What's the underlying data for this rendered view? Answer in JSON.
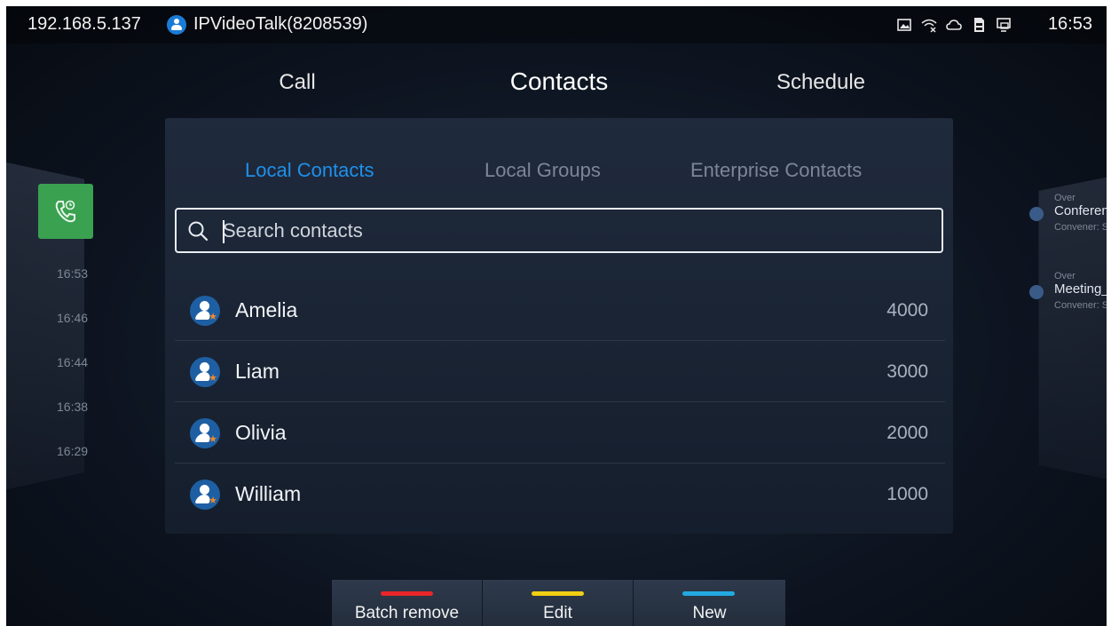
{
  "status_bar": {
    "ip": "192.168.5.137",
    "account": "IPVideoTalk(8208539)",
    "time": "16:53",
    "icons": [
      "gallery-icon",
      "wifi-off-icon",
      "cloud-icon",
      "sd-card-icon",
      "monitor-icon"
    ]
  },
  "main_tabs": [
    {
      "label": "Call"
    },
    {
      "label": "Contacts"
    },
    {
      "label": "Schedule"
    }
  ],
  "left_panel": {
    "call_log_times": [
      "16:53",
      "16:46",
      "16:44",
      "16:38",
      "16:29"
    ]
  },
  "right_panel": {
    "items": [
      {
        "status": "Over",
        "title": "Conferenc",
        "subtitle": "Convener: S"
      },
      {
        "status": "Over",
        "title": "Meeting_C",
        "subtitle": "Convener: S"
      }
    ]
  },
  "contacts": {
    "sub_tabs": [
      {
        "label": "Local Contacts",
        "active": true
      },
      {
        "label": "Local Groups",
        "active": false
      },
      {
        "label": "Enterprise Contacts",
        "active": false
      }
    ],
    "search": {
      "placeholder": "Search contacts",
      "value": ""
    },
    "list": [
      {
        "name": "Amelia",
        "number": "4000"
      },
      {
        "name": "Liam",
        "number": "3000"
      },
      {
        "name": "Olivia",
        "number": "2000"
      },
      {
        "name": "William",
        "number": "1000"
      }
    ]
  },
  "actions": [
    {
      "label": "Batch remove",
      "color": "#e8262a"
    },
    {
      "label": "Edit",
      "color": "#f2cf14"
    },
    {
      "label": "New",
      "color": "#23a9e2"
    }
  ],
  "colors": {
    "accent": "#1f90ea",
    "background": "#0d1420"
  }
}
